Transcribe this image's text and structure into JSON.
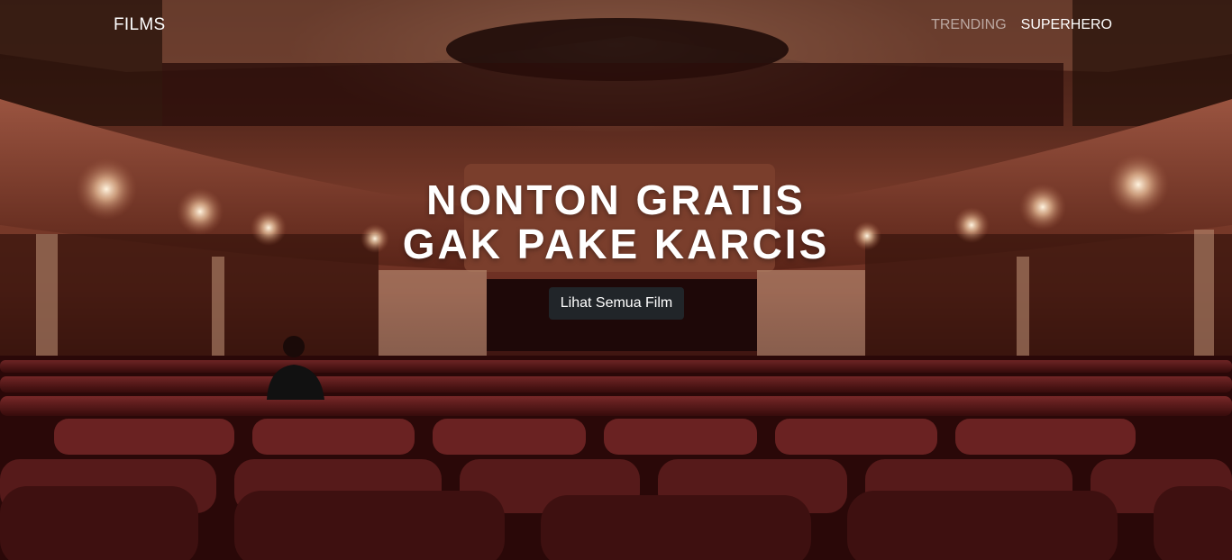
{
  "navbar": {
    "brand": "FILMS",
    "links": [
      {
        "label": "TRENDING"
      },
      {
        "label": "SUPERHERO"
      }
    ]
  },
  "hero": {
    "headline_line1": "NONTON GRATIS",
    "headline_line2": "GAK PAKE KARCIS",
    "cta_label": "Lihat Semua Film"
  },
  "colors": {
    "button_bg": "#212529",
    "tint": "#7a3b2a"
  }
}
